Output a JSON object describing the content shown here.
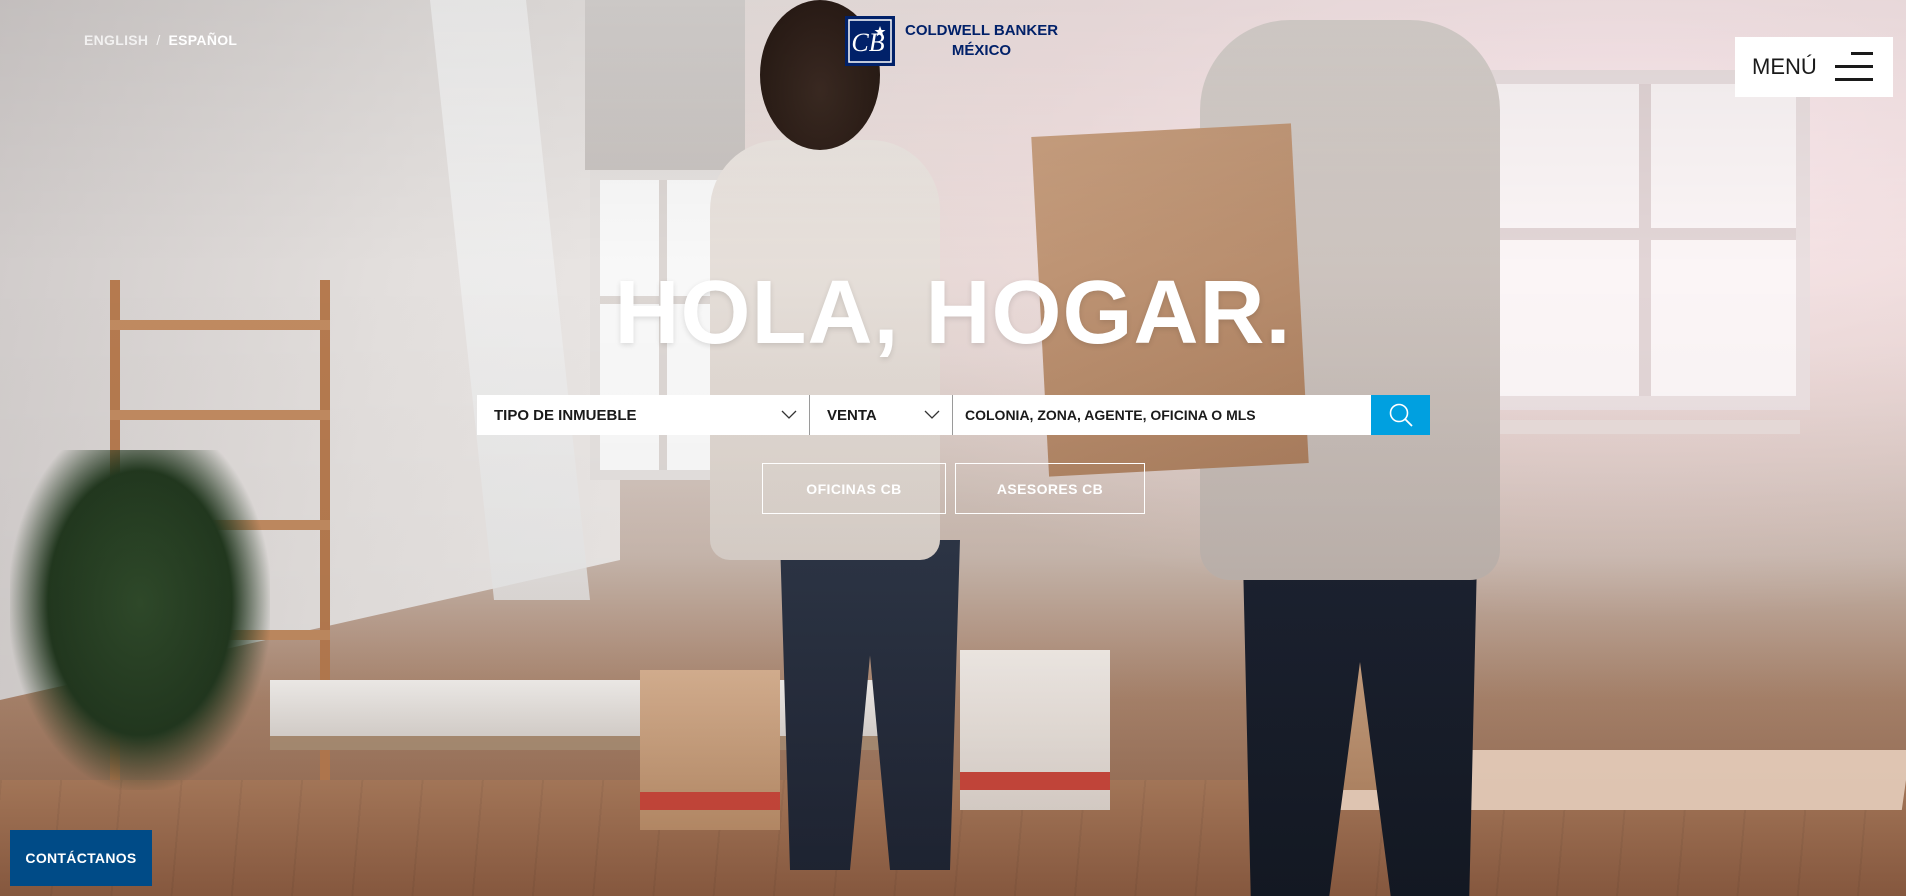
{
  "language": {
    "english_label": "ENGLISH",
    "separator": "/",
    "spanish_label": "ESPAÑOL"
  },
  "logo": {
    "line1": "COLDWELL BANKER",
    "line2": "MÉXICO",
    "mark_text": "CB"
  },
  "menu": {
    "label": "MENÚ"
  },
  "hero": {
    "title": "HOLA, HOGAR."
  },
  "search": {
    "property_type_label": "TIPO DE INMUEBLE",
    "operation_label": "VENTA",
    "input_placeholder": "COLONIA, ZONA, AGENTE, OFICINA O MLS",
    "input_value": ""
  },
  "quick_links": {
    "offices_label": "OFICINAS CB",
    "advisors_label": "ASESORES CB"
  },
  "contact": {
    "label": "CONTÁCTANOS"
  },
  "colors": {
    "brand_navy": "#012169",
    "search_button": "#00a0e0",
    "contact_button": "#004b87"
  },
  "icons": [
    "chevron-down-icon",
    "search-icon",
    "hamburger-icon",
    "cb-logo-icon"
  ]
}
